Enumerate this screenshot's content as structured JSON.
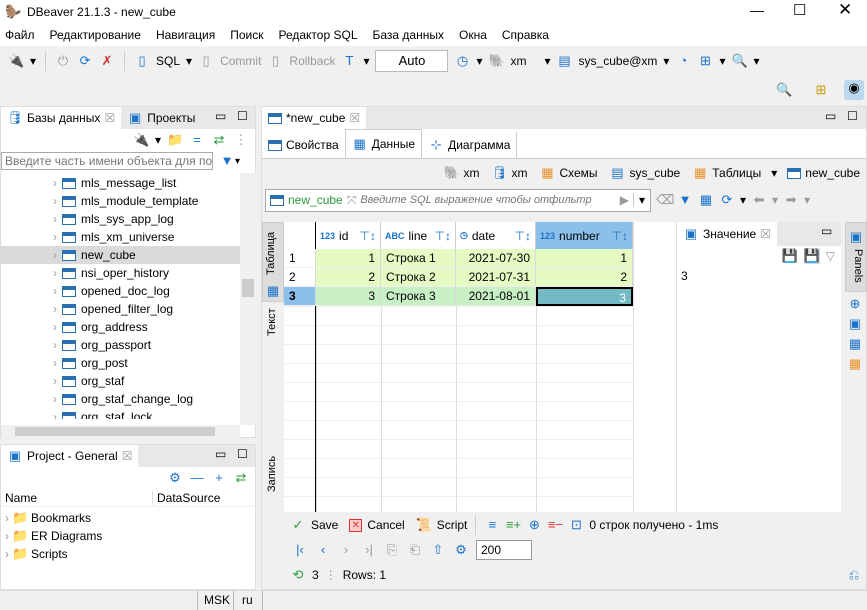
{
  "window": {
    "title": "DBeaver 21.1.3 - new_cube"
  },
  "menu": [
    "Файл",
    "Редактирование",
    "Навигация",
    "Поиск",
    "Редактор SQL",
    "База данных",
    "Окна",
    "Справка"
  ],
  "toolbar": {
    "sql": "SQL",
    "commit": "Commit",
    "rollback": "Rollback",
    "mode": "Auto",
    "datasource": "xm",
    "schema": "sys_cube@xm"
  },
  "left": {
    "tabs": [
      "Базы данных",
      "Проекты"
    ],
    "filter_placeholder": "Введите часть имени объекта для пои",
    "tree": [
      "mls_message_list",
      "mls_module_template",
      "mls_sys_app_log",
      "mls_xm_universe",
      "new_cube",
      "nsi_oper_history",
      "opened_doc_log",
      "opened_filter_log",
      "org_address",
      "org_passport",
      "org_post",
      "org_staf",
      "org_staf_change_log",
      "org_staf_lock"
    ],
    "selected": "new_cube"
  },
  "project": {
    "title": "Project - General",
    "columns": [
      "Name",
      "DataSource"
    ],
    "items": [
      "Bookmarks",
      "ER Diagrams",
      "Scripts"
    ]
  },
  "editor": {
    "tab": "*new_cube",
    "subtabs": [
      "Свойства",
      "Данные",
      "Диаграмма"
    ],
    "active_subtab": "Данные",
    "breadcrumb": [
      "xm",
      "xm",
      "Схемы",
      "sys_cube",
      "Таблицы",
      "new_cube"
    ],
    "filter": {
      "table": "new_cube",
      "placeholder": "Введите SQL выражение чтобы отфильтр"
    },
    "side_tabs": [
      "Таблица",
      "Текст",
      "Запись"
    ],
    "grid": {
      "columns": [
        {
          "name": "id",
          "type": "123"
        },
        {
          "name": "line",
          "type": "ABC"
        },
        {
          "name": "date",
          "type": "date"
        },
        {
          "name": "number",
          "type": "123"
        }
      ],
      "rows": [
        [
          "1",
          "1",
          "Строка 1",
          "2021-07-30",
          "1"
        ],
        [
          "2",
          "2",
          "Строка 2",
          "2021-07-31",
          "2"
        ],
        [
          "3",
          "3",
          "Строка 3",
          "2021-08-01",
          "3"
        ]
      ]
    },
    "value_panel": {
      "title": "Значение",
      "value": "3"
    },
    "panels_label": "Panels",
    "actions": {
      "save": "Save",
      "cancel": "Cancel",
      "script": "Script",
      "status": "0 строк получено - 1ms"
    },
    "fetch_size": "200",
    "footer": {
      "count": "3",
      "rows": "Rows: 1"
    }
  },
  "status": {
    "tz": "MSK",
    "lang": "ru"
  },
  "colors": {
    "accent": "#1a73c9",
    "row_modified": "#e6fbc4",
    "row_selected": "#c9efc4",
    "cell_selected": "#74bac4"
  }
}
